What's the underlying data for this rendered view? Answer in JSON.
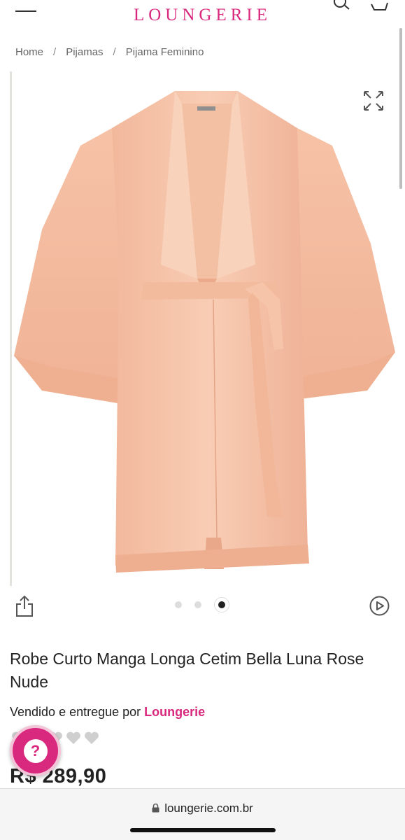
{
  "header": {
    "logo": "LOUNGERIE",
    "brand_color": "#d9297e"
  },
  "breadcrumb": {
    "items": [
      "Home",
      "Pijamas",
      "Pijama Feminino"
    ],
    "separator": "/"
  },
  "gallery": {
    "image_icon": "pink-satin-robe-photo",
    "total_images": 3,
    "active_index": 3
  },
  "product": {
    "title": "Robe Curto Manga Longa Cetim Bella Luna Rose Nude",
    "seller_prefix": "Vendido e entregue por",
    "seller_name": "Loungerie",
    "rating": 0,
    "rating_max": 5,
    "price": "R$ 289,90"
  },
  "help": {
    "label": "?"
  },
  "browser": {
    "url": "loungerie.com.br"
  },
  "colors": {
    "accent": "#d9297e",
    "robe": "#f6c3a8"
  }
}
